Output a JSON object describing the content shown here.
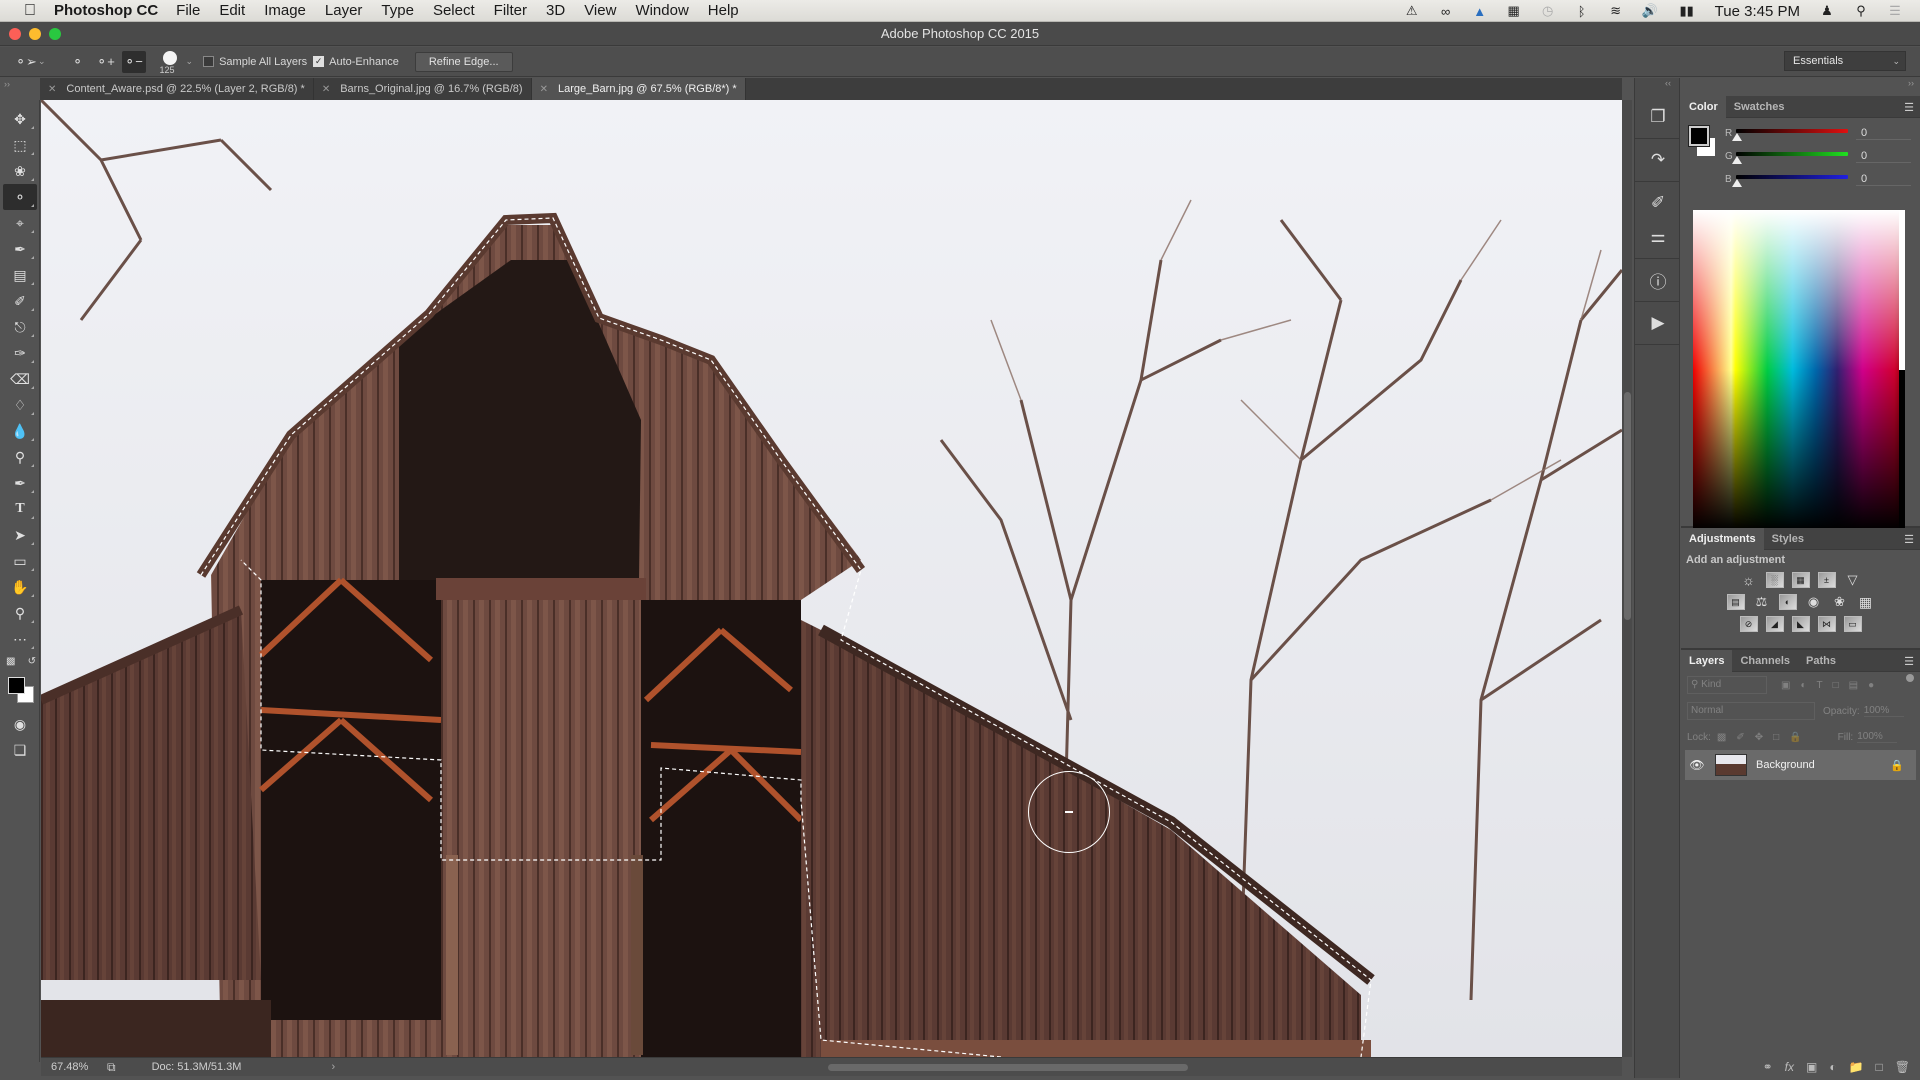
{
  "menubar": {
    "apple_icon": "apple-icon",
    "app_name": "Photoshop CC",
    "items": [
      "File",
      "Edit",
      "Image",
      "Layer",
      "Type",
      "Select",
      "Filter",
      "3D",
      "View",
      "Window",
      "Help"
    ],
    "status_icons": [
      "alert-icon",
      "creative-cloud-icon",
      "airplay-icon",
      "keyboard-icon",
      "time-machine-icon",
      "bluetooth-icon",
      "wifi-icon",
      "volume-icon",
      "battery-icon"
    ],
    "clock": "Tue 3:45 PM",
    "user_icon": "user-icon",
    "search_icon": "spotlight-icon",
    "notif_icon": "notification-center-icon"
  },
  "window": {
    "title": "Adobe Photoshop CC 2015"
  },
  "options": {
    "tool_preset_icon": "quick-selection-icon",
    "brush_size": "125",
    "sample_all_layers_label": "Sample All Layers",
    "sample_all_layers_checked": false,
    "auto_enhance_label": "Auto-Enhance",
    "auto_enhance_checked": true,
    "refine_edge_label": "Refine Edge...",
    "workspace": "Essentials"
  },
  "tabs": [
    {
      "label": "Content_Aware.psd @ 22.5% (Layer 2, RGB/8) *",
      "active": false
    },
    {
      "label": "Barns_Original.jpg @ 16.7% (RGB/8)",
      "active": false
    },
    {
      "label": "Large_Barn.jpg @ 67.5% (RGB/8*) *",
      "active": true
    }
  ],
  "tools": [
    "move",
    "rectangular-marquee",
    "lasso",
    "quick-selection",
    "crop",
    "eyedropper",
    "healing-brush",
    "brush",
    "clone-stamp",
    "history-brush",
    "eraser",
    "paint-bucket",
    "blur",
    "dodge",
    "pen",
    "type",
    "path-selection",
    "rectangle",
    "hand",
    "zoom",
    "more"
  ],
  "status": {
    "zoom": "67.48%",
    "doc": "Doc: 51.3M/51.3M",
    "arrow": "›"
  },
  "color_panel": {
    "tabs": [
      "Color",
      "Swatches"
    ],
    "active_tab": "Color",
    "foreground": "#000000",
    "background": "#ffffff",
    "channels": [
      {
        "label": "R",
        "value": "0",
        "color": "#e01010"
      },
      {
        "label": "G",
        "value": "0",
        "color": "#20e020"
      },
      {
        "label": "B",
        "value": "0",
        "color": "#2020e0"
      }
    ]
  },
  "adjustments_panel": {
    "tabs": [
      "Adjustments",
      "Styles"
    ],
    "active_tab": "Adjustments",
    "heading": "Add an adjustment",
    "row1": [
      "brightness-contrast",
      "levels",
      "curves",
      "exposure",
      "vibrance"
    ],
    "row2": [
      "hue-saturation",
      "color-balance",
      "black-white",
      "photo-filter",
      "channel-mixer",
      "color-lookup"
    ],
    "row3": [
      "invert",
      "posterize",
      "threshold",
      "selective-color",
      "gradient-map"
    ]
  },
  "layers_panel": {
    "tabs": [
      "Layers",
      "Channels",
      "Paths"
    ],
    "active_tab": "Layers",
    "filter_placeholder": "Kind",
    "blend_mode": "Normal",
    "opacity_label": "Opacity:",
    "opacity_value": "100%",
    "lock_label": "Lock:",
    "fill_label": "Fill:",
    "fill_value": "100%",
    "layers": [
      {
        "name": "Background",
        "visible": true,
        "locked": true
      }
    ],
    "bottom_icons": [
      "link-layers",
      "fx",
      "add-mask",
      "new-adjustment",
      "new-group",
      "new-layer",
      "delete-layer"
    ]
  }
}
